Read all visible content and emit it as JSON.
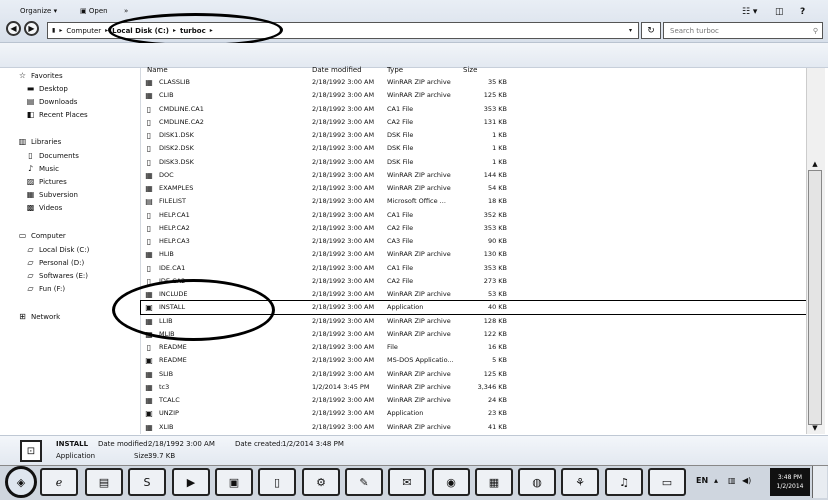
{
  "address": {
    "crumbs": [
      "Computer",
      "Local Disk (C:)",
      "turboc"
    ],
    "search_placeholder": "Search turboc"
  },
  "toolbar": {
    "organize": "Organize",
    "open": "Open"
  },
  "nav": {
    "favorites": "Favorites",
    "desktop": "Desktop",
    "downloads": "Downloads",
    "recent": "Recent Places",
    "libraries": "Libraries",
    "documents": "Documents",
    "music": "Music",
    "pictures": "Pictures",
    "subversion": "Subversion",
    "videos": "Videos",
    "computer": "Computer",
    "local_disk": "Local Disk (C:)",
    "personal": "Personal (D:)",
    "softwares": "Softwares (E:)",
    "fun": "Fun (F:)",
    "network": "Network"
  },
  "columns": {
    "name": "Name",
    "date": "Date modified",
    "type": "Type",
    "size": "Size"
  },
  "files": [
    {
      "name": "CLASSLIB",
      "date": "2/18/1992 3:00 AM",
      "type": "WinRAR ZIP archive",
      "size": "35 KB",
      "icon": "zip"
    },
    {
      "name": "CLIB",
      "date": "2/18/1992 3:00 AM",
      "type": "WinRAR ZIP archive",
      "size": "125 KB",
      "icon": "zip"
    },
    {
      "name": "CMDLINE.CA1",
      "date": "2/18/1992 3:00 AM",
      "type": "CA1 File",
      "size": "353 KB",
      "icon": "file"
    },
    {
      "name": "CMDLINE.CA2",
      "date": "2/18/1992 3:00 AM",
      "type": "CA2 File",
      "size": "131 KB",
      "icon": "file"
    },
    {
      "name": "DISK1.DSK",
      "date": "2/18/1992 3:00 AM",
      "type": "DSK File",
      "size": "1 KB",
      "icon": "file"
    },
    {
      "name": "DISK2.DSK",
      "date": "2/18/1992 3:00 AM",
      "type": "DSK File",
      "size": "1 KB",
      "icon": "file"
    },
    {
      "name": "DISK3.DSK",
      "date": "2/18/1992 3:00 AM",
      "type": "DSK File",
      "size": "1 KB",
      "icon": "file"
    },
    {
      "name": "DOC",
      "date": "2/18/1992 3:00 AM",
      "type": "WinRAR ZIP archive",
      "size": "144 KB",
      "icon": "zip"
    },
    {
      "name": "EXAMPLES",
      "date": "2/18/1992 3:00 AM",
      "type": "WinRAR ZIP archive",
      "size": "54 KB",
      "icon": "zip"
    },
    {
      "name": "FILELIST",
      "date": "2/18/1992 3:00 AM",
      "type": "Microsoft Office ...",
      "size": "18 KB",
      "icon": "doc"
    },
    {
      "name": "HELP.CA1",
      "date": "2/18/1992 3:00 AM",
      "type": "CA1 File",
      "size": "352 KB",
      "icon": "file"
    },
    {
      "name": "HELP.CA2",
      "date": "2/18/1992 3:00 AM",
      "type": "CA2 File",
      "size": "353 KB",
      "icon": "file"
    },
    {
      "name": "HELP.CA3",
      "date": "2/18/1992 3:00 AM",
      "type": "CA3 File",
      "size": "90 KB",
      "icon": "file"
    },
    {
      "name": "HLIB",
      "date": "2/18/1992 3:00 AM",
      "type": "WinRAR ZIP archive",
      "size": "130 KB",
      "icon": "zip"
    },
    {
      "name": "IDE.CA1",
      "date": "2/18/1992 3:00 AM",
      "type": "CA1 File",
      "size": "353 KB",
      "icon": "file"
    },
    {
      "name": "IDE.CA2",
      "date": "2/18/1992 3:00 AM",
      "type": "CA2 File",
      "size": "273 KB",
      "icon": "file"
    },
    {
      "name": "INCLUDE",
      "date": "2/18/1992 3:00 AM",
      "type": "WinRAR ZIP archive",
      "size": "53 KB",
      "icon": "zip"
    },
    {
      "name": "INSTALL",
      "date": "2/18/1992 3:00 AM",
      "type": "Application",
      "size": "40 KB",
      "icon": "app",
      "selected": true
    },
    {
      "name": "LLIB",
      "date": "2/18/1992 3:00 AM",
      "type": "WinRAR ZIP archive",
      "size": "128 KB",
      "icon": "zip"
    },
    {
      "name": "MLIB",
      "date": "2/18/1992 3:00 AM",
      "type": "WinRAR ZIP archive",
      "size": "122 KB",
      "icon": "zip"
    },
    {
      "name": "README",
      "date": "2/18/1992 3:00 AM",
      "type": "File",
      "size": "16 KB",
      "icon": "file"
    },
    {
      "name": "README",
      "date": "2/18/1992 3:00 AM",
      "type": "MS-DOS Applicatio...",
      "size": "5 KB",
      "icon": "app"
    },
    {
      "name": "SLIB",
      "date": "2/18/1992 3:00 AM",
      "type": "WinRAR ZIP archive",
      "size": "125 KB",
      "icon": "zip"
    },
    {
      "name": "tc3",
      "date": "1/2/2014 3:45 PM",
      "type": "WinRAR ZIP archive",
      "size": "3,346 KB",
      "icon": "zip"
    },
    {
      "name": "TCALC",
      "date": "2/18/1992 3:00 AM",
      "type": "WinRAR ZIP archive",
      "size": "24 KB",
      "icon": "zip"
    },
    {
      "name": "UNZIP",
      "date": "2/18/1992 3:00 AM",
      "type": "Application",
      "size": "23 KB",
      "icon": "app"
    },
    {
      "name": "XLIB",
      "date": "2/18/1992 3:00 AM",
      "type": "WinRAR ZIP archive",
      "size": "41 KB",
      "icon": "zip"
    }
  ],
  "details": {
    "name": "INSTALL",
    "type": "Application",
    "date_modified_label": "Date modified:",
    "date_modified": "2/18/1992 3:00 AM",
    "date_created_label": "Date created:",
    "date_created": "1/2/2014 3:48 PM",
    "size_label": "Size:",
    "size": "39.7 KB"
  },
  "taskbar": {
    "lang": "EN",
    "time": "3:48 PM",
    "date": "1/2/2014"
  }
}
